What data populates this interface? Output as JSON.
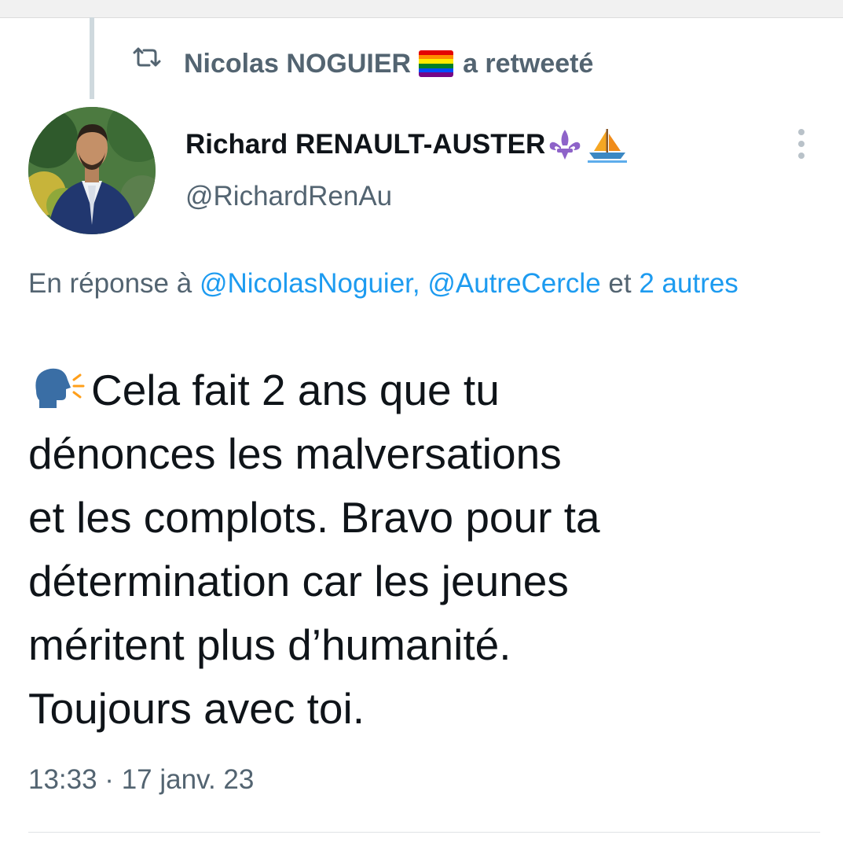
{
  "retweet": {
    "icon": "retweet-icon",
    "user_name": "Nicolas NOGUIER",
    "flag": "rainbow-flag",
    "suffix": "a retweeté"
  },
  "author": {
    "display_name": "Richard RENAULT-AUSTER",
    "name_emojis": [
      "fleur-de-lis",
      "sailboat"
    ],
    "handle": "@RichardRenAu"
  },
  "reply": {
    "prefix": "En réponse à",
    "mention_1": "@NicolasNoguier,",
    "mention_2": "@AutreCercle",
    "connector": "et",
    "others": "2 autres"
  },
  "tweet": {
    "emoji": "speaking-head",
    "lines": [
      "Cela fait 2 ans que tu",
      "dénonces les malversations",
      "et les complots. Bravo pour ta",
      "détermination car les jeunes",
      "méritent plus d’humanité.",
      "Toujours avec toi."
    ]
  },
  "timestamp": "13:33 · 17 janv. 23",
  "colors": {
    "text": "#0f1419",
    "secondary": "#536471",
    "link": "#1d9bf0",
    "fleur": "#8e63c9"
  }
}
